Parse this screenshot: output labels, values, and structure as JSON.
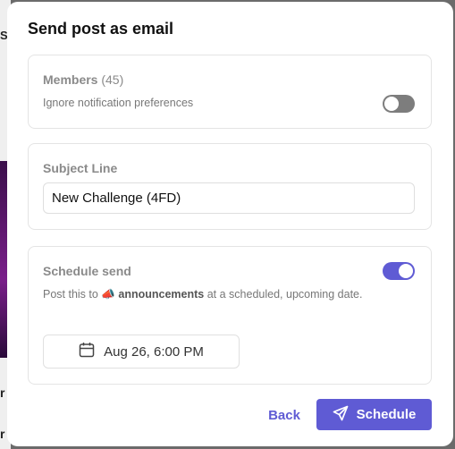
{
  "modal": {
    "title": "Send post as email"
  },
  "members": {
    "label": "Members",
    "count": "(45)",
    "description": "Ignore notification preferences",
    "toggle_on": false
  },
  "subject": {
    "label": "Subject Line",
    "value": "New Challenge (4FD)"
  },
  "schedule": {
    "label": "Schedule send",
    "toggle_on": true,
    "desc_prefix": "Post this to",
    "channel_emoji": "📣",
    "channel": "announcements",
    "desc_suffix": "at a scheduled, upcoming date.",
    "date": "Aug 26, 6:00 PM"
  },
  "footer": {
    "back_label": "Back",
    "schedule_label": "Schedule"
  },
  "background": {
    "chars": [
      "S",
      "r",
      "r"
    ]
  },
  "colors": {
    "accent": "#5f5bd4",
    "toggle_off": "#7d7d7d"
  }
}
